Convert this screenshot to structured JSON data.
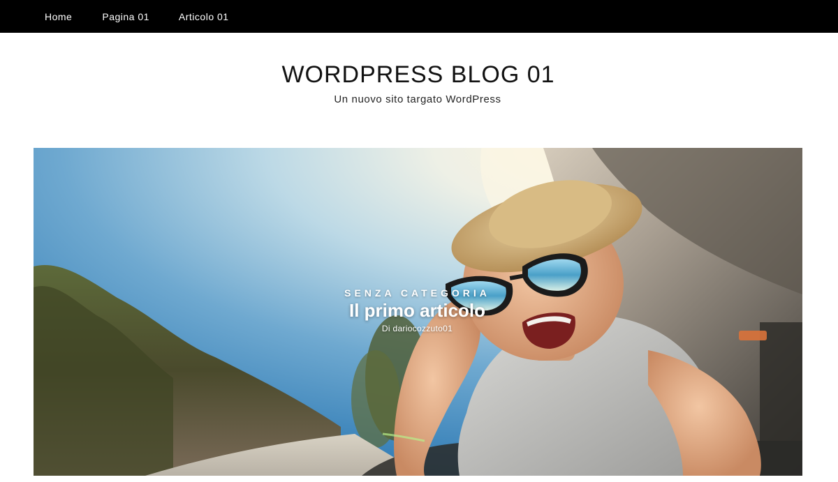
{
  "nav": {
    "items": [
      {
        "label": "Home"
      },
      {
        "label": "Pagina 01"
      },
      {
        "label": "Articolo 01"
      }
    ]
  },
  "header": {
    "site_title": "WORDPRESS BLOG 01",
    "tagline": "Un nuovo sito targato WordPress"
  },
  "featured_post": {
    "category": "Senza categoria",
    "title": "Il primo articolo",
    "author_line": "Di dariocozzuto01",
    "image_subject": "laughing-boy-car-window-photo"
  },
  "colors": {
    "nav_background": "#000000",
    "nav_text": "#ffffff",
    "page_background": "#ffffff",
    "title_text": "#111111"
  }
}
